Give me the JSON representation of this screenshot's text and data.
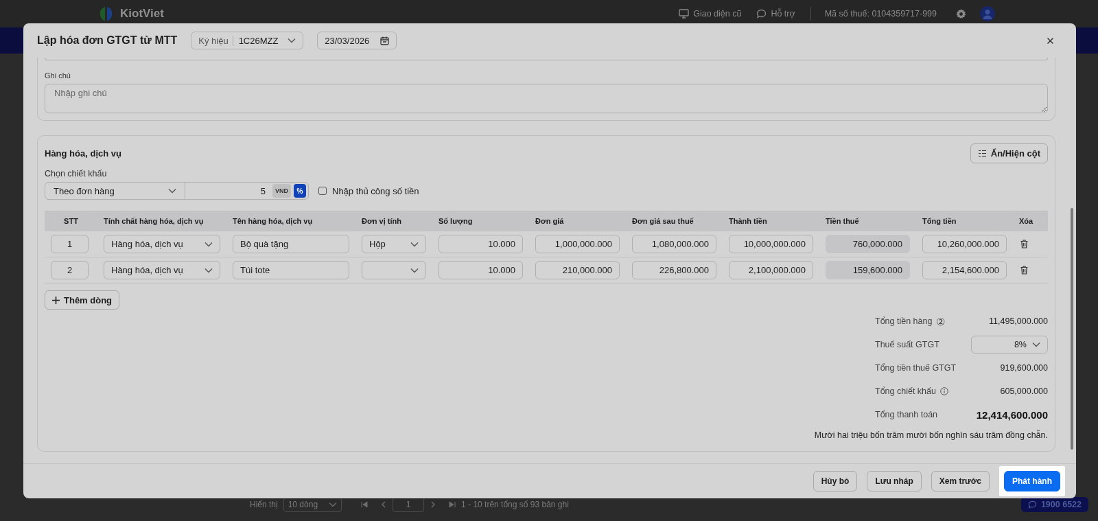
{
  "app_bar": {
    "logo": "KiotViet",
    "links": [
      "Giao diện cũ",
      "Hỗ trợ"
    ],
    "tax_id": "Mã số thuế: 0104359717-999"
  },
  "list_footer": {
    "page_size_label": "Hiển thị",
    "page_size": "10 dòng",
    "page": "1",
    "range": "1 - 10 trên tổng số 93 bản ghi",
    "hotline": "1900 6522"
  },
  "dialog": {
    "title": "Lập hóa đơn GTGT từ MTT",
    "symbol": {
      "label": "Ký hiệu",
      "value": "1C26MZZ"
    },
    "date": "23/03/2026",
    "notes": {
      "label": "Ghi chú",
      "placeholder": "Nhập ghi chú"
    },
    "goods": {
      "title": "Hàng hóa, dịch vụ",
      "columns_toggle": "Ẩn/Hiện cột",
      "discount": {
        "label": "Chọn chiết khấu",
        "mode": "Theo đơn hàng",
        "value": "5",
        "units": [
          {
            "label": "VND",
            "selected": false
          },
          {
            "label": "%",
            "selected": true
          }
        ],
        "manual": {
          "label": "Nhập thủ công số tiền",
          "checked": false
        }
      },
      "columns": [
        {
          "label": "STT",
          "kind": "index"
        },
        {
          "label": "Tính chất hàng hóa, dịch vụ",
          "kind": "select"
        },
        {
          "label": "Tên hàng hóa, dịch vụ",
          "kind": "text"
        },
        {
          "label": "Đơn vị tính",
          "kind": "select"
        },
        {
          "label": "Số lượng",
          "kind": "number"
        },
        {
          "label": "Đơn giá",
          "kind": "number"
        },
        {
          "label": "Đơn giá sau thuế",
          "kind": "number"
        },
        {
          "label": "Thành tiền",
          "kind": "number"
        },
        {
          "label": "Tiền thuế",
          "kind": "readonly"
        },
        {
          "label": "Tổng tiền",
          "kind": "number"
        },
        {
          "label": "Xóa",
          "kind": "action"
        }
      ],
      "rows": [
        {
          "cells": [
            "1",
            "Hàng hóa, dịch vụ",
            "Bộ quà tặng",
            "Hộp",
            "10.000",
            "1,000,000.000",
            "1,080,000.000",
            "10,000,000.000",
            "760,000.000",
            "10,260,000.000"
          ]
        },
        {
          "cells": [
            "2",
            "Hàng hóa, dịch vụ",
            "Túi tote",
            null,
            "10.000",
            "210,000.000",
            "226,800.000",
            "2,100,000.000",
            "159,600.000",
            "2,154,600.000"
          ]
        }
      ],
      "add_row": "Thêm dòng",
      "summary": [
        {
          "kind": "amount",
          "label": "Tổng tiền hàng",
          "badge": "②",
          "value": "11,495,000.000"
        },
        {
          "kind": "select",
          "label": "Thuế suất GTGT",
          "value": "8%"
        },
        {
          "kind": "amount",
          "label": "Tổng tiền thuế GTGT",
          "value": "919,600.000"
        },
        {
          "kind": "amount",
          "label": "Tổng chiết khấu",
          "info": true,
          "value": "605,000.000"
        },
        {
          "kind": "total",
          "label": "Tổng thanh toán",
          "value": "12,414,600.000"
        }
      ],
      "in_words": "Mười hai triệu bốn trăm mười bốn nghìn sáu trăm đồng chẵn."
    },
    "buttons": [
      {
        "label": "Hủy bỏ",
        "primary": false
      },
      {
        "label": "Lưu nháp",
        "primary": false
      },
      {
        "label": "Xem trước",
        "primary": false
      },
      {
        "label": "Phát hành",
        "primary": true
      }
    ]
  }
}
